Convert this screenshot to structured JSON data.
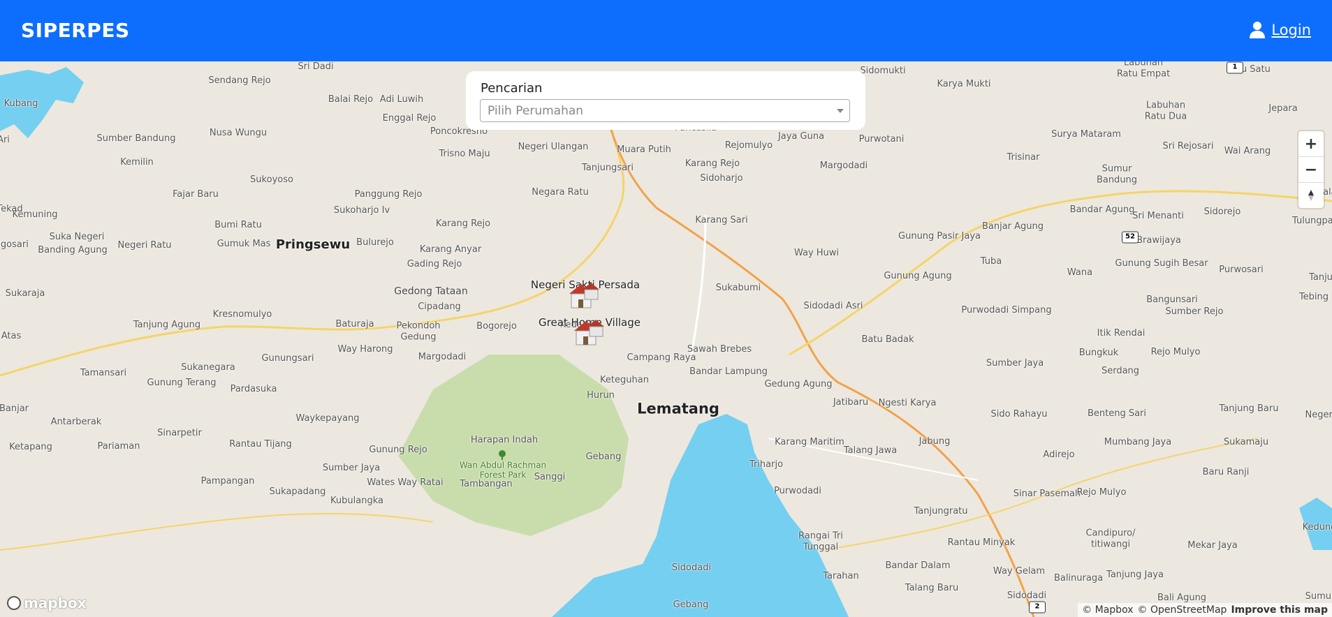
{
  "navbar": {
    "brand": "SIPERPES",
    "login_label": "Login",
    "color": "#0d6efd"
  },
  "search": {
    "title": "Pencarian",
    "placeholder": "Pilih Perumahan"
  },
  "map_controls": {
    "zoom_in": "+",
    "zoom_out": "−",
    "compass": "compass-icon"
  },
  "markers": [
    {
      "label": "Negeri Sakti Persada"
    },
    {
      "label": "Great Home Village"
    }
  ],
  "places": [
    "Sri Dadi",
    "Sendang Rejo",
    "Balai Rejo",
    "Adi Luwih",
    "Enggal Rejo",
    "Poncokresno",
    "Sumber Bandung",
    "Nusa Wungu",
    "Kemilin",
    "Sukoyoso",
    "Fajar Baru",
    "Panggung Rejo",
    "Sukoharjo Iv",
    "Kemuning",
    "Bumi Ratu",
    "Suka Negeri",
    "Banding Agung",
    "Negeri Ratu",
    "Gumuk Mas",
    "Pringsewu",
    "Bulurejo",
    "Karang Rejo",
    "Karang Anyar",
    "Gading Rejo",
    "Gedong Tataan",
    "Cipadang",
    "Sukaraja",
    "Kresnomulyo",
    "Baturaja",
    "Tanjung Agung",
    "Pekondoh Gedung",
    "Bogorejo",
    "Kedaung",
    "Way Harong",
    "Margodadi",
    "Gunungsari",
    "Sukanegara",
    "Tamansari",
    "Gunung Terang",
    "Pardasuka",
    "Atas",
    "Waykepayang",
    "Banjar",
    "Antarberak",
    "Sinarpetir",
    "Pariaman",
    "Ketapang",
    "Rantau Tijang",
    "Gunung Rejo",
    "Sumber Jaya",
    "Pampangan",
    "Sukapadang",
    "Wates Way Ratai",
    "Kubulangka",
    "Tambangan",
    "Sanggi",
    "Gebang",
    "Harapan Indah",
    "Hurun",
    "Keteguhan",
    "Wan Abdul Rachman Forest Park",
    "Negeri Ulangan",
    "Trisno Maju",
    "Muara Putih",
    "Tanjungsari",
    "Negara Ratu",
    "Pancasila",
    "Rejomulyo",
    "Karang Rejo",
    "Karang Sari",
    "Sidoharjo",
    "Jaya Guna",
    "Purwotani",
    "Margodadi",
    "Way Huwi",
    "Sukabumi",
    "Sawah Brebes",
    "Campang Raya",
    "Bandar Lampung",
    "Lematang",
    "Gedung Agung",
    "Sidodadi Asri",
    "Gunung Agung",
    "Gunung Pasir Jaya",
    "Tuba",
    "Banjar Agung",
    "Bandar Agung",
    "Sri Menanti",
    "Sidorejo",
    "Brawijaya",
    "Gunung Sugih Besar",
    "Wana",
    "Purwosari",
    "Bangunsari",
    "Purwodadi Simpang",
    "Batu Badak",
    "Itik Rendai",
    "Sumber Rejo",
    "Bungkuk",
    "Rejo Mulyo",
    "Sumber Jaya",
    "Serdang",
    "Jatibaru",
    "Ngesti Karya",
    "Sido Rahayu",
    "Benteng Sari",
    "Tanjung Baru",
    "Karang Maritim",
    "Triharjo",
    "Talang Jawa",
    "Jabung",
    "Mumbang Jaya",
    "Sukamaju",
    "Adirejo",
    "Baru Ranji",
    "Purwodadi",
    "Sinar Pasemah",
    "Rejo Mulyo",
    "Tanjungratu",
    "Candipuro/ titiwangi",
    "Rangai Tri Tunggal",
    "Rantau Minyak",
    "Mekar Jaya",
    "Bandar Dalam",
    "Way Gelam",
    "Tarahan",
    "Talang Baru",
    "Sidodadi",
    "Balinuraga",
    "Tanjung Jaya",
    "Bali Agung",
    "Sidomukti",
    "Karya Mukti",
    "Labuhan Ratu Dua",
    "Surya Mataram",
    "Sri Rejosari",
    "Trisinar",
    "Sumur Bandung",
    "Wai Arang",
    "Labuhan Ratu Empat",
    "Ratu Satu",
    "Jepara",
    "Mandala",
    "Tulungpasik",
    "Tanju",
    "Tebing",
    "Negeri",
    "Sumur",
    "Kedung",
    "Gebang",
    "Sidodadi",
    "Tekad",
    "Kubang",
    "Ari",
    "Ngosari"
  ],
  "highways": [
    "1",
    "52",
    "2"
  ],
  "attribution": {
    "mapbox": "© Mapbox",
    "osm": "© OpenStreetMap",
    "improve": "Improve this map"
  },
  "mapbox_logo": "mapbox"
}
